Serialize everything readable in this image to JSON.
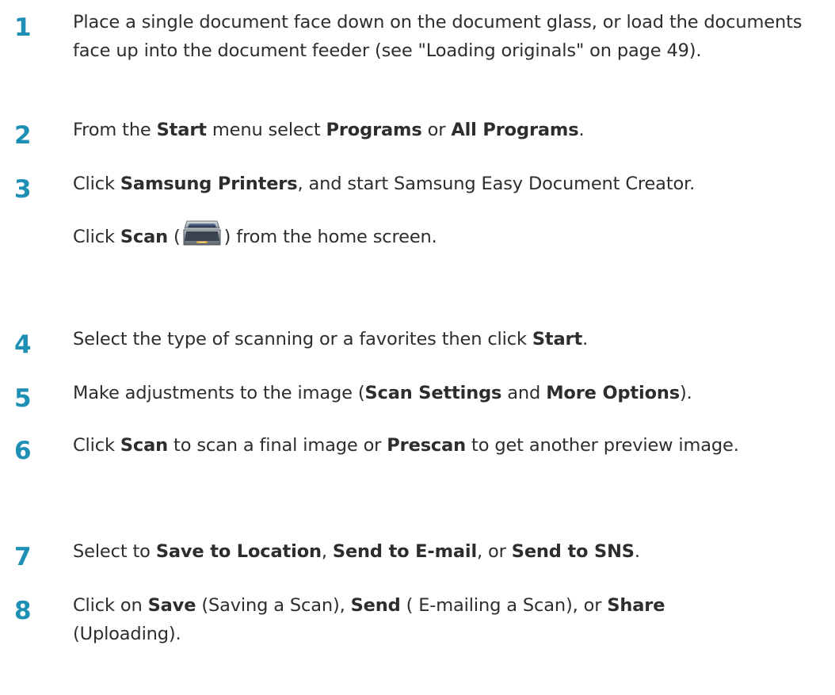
{
  "accent_color": "#1e8fb5",
  "steps": [
    {
      "number": "1",
      "text": "Place a single document face down on the document glass, or load the documents face up into the document feeder (see \"Loading originals\" on page 49)."
    },
    {
      "number": "2",
      "t1": "From the ",
      "b1": "Start",
      "t2": " menu select ",
      "b2": "Programs",
      "t3": " or ",
      "b3": "All Programs",
      "t4": "."
    },
    {
      "number": "3",
      "t1": "Click ",
      "b1": "Samsung Printers",
      "t2": ", and start Samsung Easy Document Creator.",
      "sub_t1": "Click ",
      "sub_b1": "Scan",
      "sub_t2": " (",
      "sub_icon": "scanner-icon",
      "sub_t3": ") from the home screen."
    },
    {
      "number": "4",
      "t1": "Select the type of scanning or a favorites then click ",
      "b1": "Start",
      "t2": "."
    },
    {
      "number": "5",
      "t1": "Make adjustments to the image (",
      "b1": "Scan Settings",
      "t2": " and ",
      "b2": "More Options",
      "t3": ")."
    },
    {
      "number": "6",
      "t1": "Click ",
      "b1": "Scan",
      "t2": " to scan a final image or ",
      "b2": "Prescan",
      "t3": " to get another preview image."
    },
    {
      "number": "7",
      "t1": "Select to ",
      "b1": "Save to Location",
      "t2": ", ",
      "b2": "Send to E-mail",
      "t3": ", or ",
      "b3": "Send to SNS",
      "t4": "."
    },
    {
      "number": "8",
      "t1": "Click on ",
      "b1": "Save",
      "t2": " (Saving a Scan), ",
      "b2": "Send",
      "t3": " ( E-mailing a Scan), or ",
      "b3": "Share",
      "t4": " (Uploading)."
    }
  ]
}
